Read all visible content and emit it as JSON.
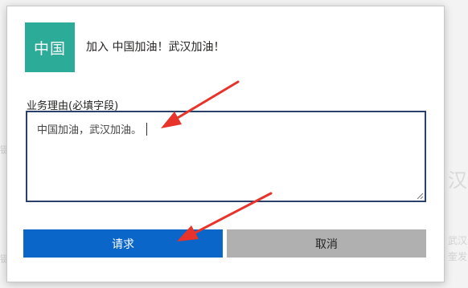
{
  "background": {
    "fragments": [
      "汉.",
      "武汉",
      "奎发",
      "键",
      "键"
    ]
  },
  "dialog": {
    "team_logo_text": "中国",
    "join_title": "加入 中国加油！武汉加油！",
    "reason_label": "业务理由(必填字段)",
    "reason_value": "中国加油，武汉加油。",
    "request_label": "请求",
    "cancel_label": "取消"
  },
  "colors": {
    "logo_bg": "#2bab98",
    "primary_button": "#0a66c9",
    "secondary_button": "#b0b0b0",
    "annotation_arrow": "#e8332a"
  },
  "icons": {
    "resize_grip": "resize-grip-icon",
    "annotation_arrows": "red-arrow-icon"
  }
}
